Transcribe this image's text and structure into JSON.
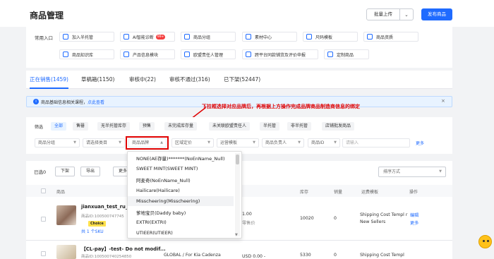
{
  "header": {
    "title": "商品管理",
    "batch_upload": "批量上传",
    "publish": "发布商品"
  },
  "quick_links": {
    "label": "常用入口",
    "items": [
      {
        "label": "加入半托管"
      },
      {
        "label": "AI智能诊断",
        "badge": "99+"
      },
      {
        "label": "商品分组"
      },
      {
        "label": "素材中心"
      },
      {
        "label": "尺码模板"
      },
      {
        "label": "商品资质"
      },
      {
        "label": "商品知识库"
      },
      {
        "label": "产品信息模块"
      },
      {
        "label": "欧盟责任人管理"
      },
      {
        "label": "跨平台同款铺货及评价申报"
      },
      {
        "label": "定制商品"
      }
    ]
  },
  "tabs": [
    {
      "label": "正在销售(1459)"
    },
    {
      "label": "草稿箱(1150)"
    },
    {
      "label": "审核中(22)"
    },
    {
      "label": "审核不通过(316)"
    },
    {
      "label": "已下架(52447)"
    }
  ],
  "info_bar": {
    "text": "商品基础信息相关课程，",
    "link": "点此查看"
  },
  "annotation": "下拉框选择对应品牌后，再根据上方操作完成品牌商品制造商信息的绑定",
  "filter": {
    "label": "筛选",
    "chips": [
      "全部",
      "售罄",
      "无半托管库存",
      "预售",
      "未完成库存量",
      "未关联欧盟责任人",
      "半托管",
      "非半托管",
      "店铺批发商品"
    ],
    "selects": [
      "商品分组",
      "请选择类目",
      "商品品牌",
      "区域定价",
      "运营模板",
      "商品负责人",
      "商品ID"
    ],
    "search_placeholder": "请输入",
    "search_link": "更多"
  },
  "toolbar": {
    "selected": "已选0",
    "buttons": [
      "下架",
      "导出",
      "更多"
    ],
    "sort": "排序方式"
  },
  "table": {
    "columns": [
      "商品",
      "库存",
      "销量",
      "运费模板",
      "操作"
    ],
    "rows": [
      {
        "title": "jianxuan_test_ru_cat",
        "id": "商品ID:100500747745",
        "choice": "Choice",
        "sku": "共 1 个SKU",
        "price": "1.00",
        "price_note": "零售价",
        "stock": "10020",
        "sales": "0",
        "shipping": "Shipping Cost Templ r New Sellers",
        "ops": [
          "编辑",
          "更多"
        ]
      },
      {
        "title": "【CL-pay】-test- Do not modif...",
        "id": "商品ID:100500740254850",
        "region": "GLOBAL / For Kia Cadenza",
        "price": "USD 0.00 -",
        "stock": "5330",
        "sales": "0",
        "shipping": "Shipping Cost Templ"
      }
    ]
  },
  "brand_dropdown": {
    "options": [
      "NONE(AE存量)*******(NoEnName_Null)",
      "SWEET MINT(SWEET MINT)",
      "阿麦奇(NoEnName_Null)",
      "Hailicare(Hailicare)",
      "Misscheering(Misscheering)",
      "爹地宝贝(Daddy baby)",
      "EXTRI(EXTRI)",
      "UTIEER(UTIEER)"
    ],
    "highlighted_index": 4
  }
}
